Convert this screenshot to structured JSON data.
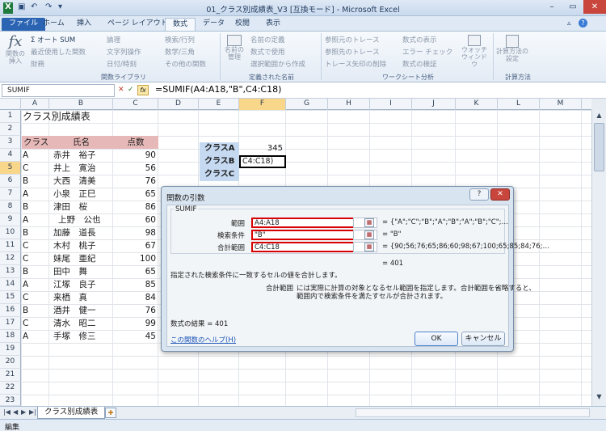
{
  "window": {
    "title": "01_クラス別成績表_V3 [互換モード] - Microsoft Excel",
    "controls": [
      "–",
      "▭",
      "✕"
    ]
  },
  "ribbon_tabs": [
    "ファイル",
    "ホーム",
    "挿入",
    "ページ レイアウト",
    "数式",
    "データ",
    "校閲",
    "表示"
  ],
  "active_tab": "数式",
  "ribbon": {
    "fx_label": "関数の挿入",
    "lib_items": [
      "Σ オート SUM",
      "最近使用した関数",
      "財務",
      "論理",
      "文字列操作",
      "日付/時刻",
      "検索/行列",
      "数学/三角",
      "その他の関数"
    ],
    "lib_group": "関数ライブラリ",
    "names_btn": "名前の管理",
    "names_items": [
      "名前の定義",
      "数式で使用",
      "選択範囲から作成"
    ],
    "names_group": "定義された名前",
    "audit_items": [
      "参照元のトレース",
      "参照先のトレース",
      "トレース矢印の削除",
      "数式の表示",
      "エラー チェック",
      "数式の検証"
    ],
    "watch": "ウォッチ ウィンドウ",
    "audit_group": "ワークシート分析",
    "calc_btn": "計算方法の設定",
    "calc_group": "計算方法"
  },
  "formula_bar": {
    "name_box": "SUMIF",
    "formula": "=SUMIF(A4:A18,\"B\",C4:C18)",
    "fx": "fx"
  },
  "columns": [
    "A",
    "B",
    "C",
    "D",
    "E",
    "F",
    "G",
    "H",
    "I",
    "J",
    "K",
    "L",
    "M"
  ],
  "rows": [
    "1",
    "2",
    "3",
    "4",
    "5",
    "6",
    "7",
    "8",
    "9",
    "10",
    "11",
    "12",
    "13",
    "14",
    "15",
    "16",
    "17",
    "18",
    "19",
    "20",
    "21",
    "22",
    "23"
  ],
  "sheet": {
    "title": "クラス別成績表",
    "headers": {
      "class": "クラス",
      "name": "氏名",
      "score": "点数"
    },
    "data": [
      {
        "class": "A",
        "name": "赤井　裕子",
        "score": "90"
      },
      {
        "class": "C",
        "name": "井上　寛治",
        "score": "56"
      },
      {
        "class": "B",
        "name": "大西　清美",
        "score": "76"
      },
      {
        "class": "A",
        "name": "小泉　正巳",
        "score": "65"
      },
      {
        "class": "B",
        "name": "津田　桜",
        "score": "86"
      },
      {
        "class": "A",
        "name": "上野　公也",
        "score": "60"
      },
      {
        "class": "B",
        "name": "加藤　道長",
        "score": "98"
      },
      {
        "class": "C",
        "name": "木村　桃子",
        "score": "67"
      },
      {
        "class": "C",
        "name": "妹尾　亜紀",
        "score": "100"
      },
      {
        "class": "B",
        "name": "田中　舞",
        "score": "65"
      },
      {
        "class": "A",
        "name": "江塚　良子",
        "score": "85"
      },
      {
        "class": "C",
        "name": "来栖　真",
        "score": "84"
      },
      {
        "class": "B",
        "name": "酒井　健一",
        "score": "76"
      },
      {
        "class": "C",
        "name": "清水　昭二",
        "score": "99"
      },
      {
        "class": "A",
        "name": "手塚　修三",
        "score": "45"
      }
    ],
    "summary": [
      {
        "label": "クラスA",
        "value": "345"
      },
      {
        "label": "クラスB",
        "value": "C4:C18)"
      },
      {
        "label": "クラスC",
        "value": ""
      }
    ]
  },
  "dialog": {
    "title": "関数の引数",
    "func": "SUMIF",
    "args": [
      {
        "label": "範囲",
        "value": "A4:A18",
        "result": "= {\"A\";\"C\";\"B\";\"A\";\"B\";\"A\";\"B\";\"C\";…"
      },
      {
        "label": "検索条件",
        "value": "\"B\"",
        "result": "= \"B\""
      },
      {
        "label": "合計範囲",
        "value": "C4:C18",
        "result": "= {90;56;76;65;86;60;98;67;100;65;85;84;76;…"
      }
    ],
    "eq_result": "= 401",
    "description": "指定された検索条件に一致するセルの値を合計します。",
    "param_name": "合計範囲",
    "param_desc_1": "には実際に計算の対象となるセル範囲を指定します。合計範囲を省略すると、",
    "param_desc_2": "範囲内で検索条件を満たすセルが合計されます。",
    "formula_result": "数式の結果 =  401",
    "help_link": "この関数のヘルプ(H)",
    "ok": "OK",
    "cancel": "キャンセル",
    "help_btn": "?",
    "close_btn": "✕"
  },
  "sheet_tabs": {
    "active": "クラス別成績表"
  },
  "status": "編集"
}
